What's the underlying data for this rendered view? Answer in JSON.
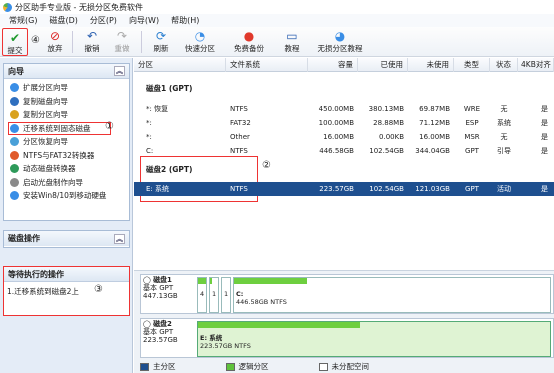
{
  "window": {
    "title": "分区助手专业版 - 无损分区免费软件"
  },
  "menu": [
    "常规(G)",
    "磁盘(D)",
    "分区(P)",
    "向导(W)",
    "帮助(H)"
  ],
  "toolbar": {
    "submit": "提交",
    "discard": "放弃",
    "undo": "撤销",
    "redo": "重做",
    "refresh": "刷新",
    "quick_partition": "快速分区",
    "free_backup": "免费备份",
    "tutorial": "教程",
    "lossless_tutorial": "无损分区教程",
    "marker4": "④"
  },
  "wizard": {
    "title": "向导",
    "items": [
      {
        "label": "扩展分区向导",
        "color": "#3a8ee6"
      },
      {
        "label": "复制磁盘向导",
        "color": "#2f6fbf"
      },
      {
        "label": "复制分区向导",
        "color": "#d9a21f"
      },
      {
        "label": "迁移系统到固态磁盘",
        "color": "#3a8ee6"
      },
      {
        "label": "分区恢复向导",
        "color": "#4aa0d8"
      },
      {
        "label": "NTFS与FAT32转换器",
        "color": "#e05a2a"
      },
      {
        "label": "动态磁盘转换器",
        "color": "#2e9a5a"
      },
      {
        "label": "启动光盘制作向导",
        "color": "#8a8a8a"
      },
      {
        "label": "安装Win8/10到移动硬盘",
        "color": "#3a8ee6"
      }
    ],
    "marker1": "①"
  },
  "disk_ops": {
    "title": "磁盘操作"
  },
  "pending": {
    "title": "等待执行的操作",
    "items": [
      "1.迁移系统到磁盘2上"
    ],
    "marker3": "③"
  },
  "columns": [
    "分区",
    "文件系统",
    "容量",
    "已使用",
    "未使用",
    "类型",
    "状态",
    "4KB对齐"
  ],
  "disk1": {
    "title": "磁盘1 (GPT)",
    "rows": [
      [
        "*: 恢复",
        "NTFS",
        "450.00MB",
        "380.13MB",
        "69.87MB",
        "WRE",
        "无",
        "是"
      ],
      [
        "*:",
        "FAT32",
        "100.00MB",
        "28.88MB",
        "71.12MB",
        "ESP",
        "系统",
        "是"
      ],
      [
        "*:",
        "Other",
        "16.00MB",
        "0.00KB",
        "16.00MB",
        "MSR",
        "无",
        "是"
      ],
      [
        "C:",
        "NTFS",
        "446.58GB",
        "102.54GB",
        "344.04GB",
        "GPT",
        "引导",
        "是"
      ]
    ]
  },
  "disk2": {
    "title": "磁盘2 (GPT)",
    "marker2": "②",
    "rows": [
      [
        "E: 系统",
        "NTFS",
        "223.57GB",
        "102.54GB",
        "121.03GB",
        "GPT",
        "活动",
        "是"
      ]
    ]
  },
  "map": {
    "disk1": {
      "name": "磁盘1",
      "type": "基本 GPT",
      "size": "447.13GB",
      "small": [
        "4",
        "1",
        "1"
      ],
      "c_label": "C:",
      "c_info": "446.58GB NTFS",
      "used_fraction": 0.23
    },
    "disk2": {
      "name": "磁盘2",
      "type": "基本 GPT",
      "size": "223.57GB",
      "e_label": "E: 系统",
      "e_info": "223.57GB NTFS",
      "used_fraction": 0.46
    }
  },
  "legend": {
    "primary": "主分区",
    "logical": "逻辑分区",
    "unallocated": "未分配空间"
  },
  "colors": {
    "primary": "#1e4f8f",
    "logical": "#5fc23c",
    "unallocated": "#ffffff",
    "used": "#6ecf3f",
    "highlight": "#ee3333"
  }
}
